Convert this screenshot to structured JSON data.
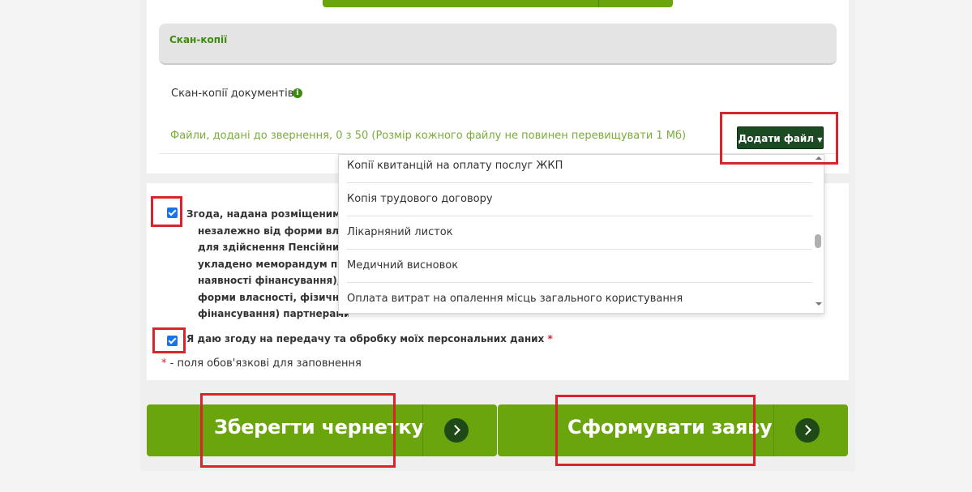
{
  "scans": {
    "header": "Скан-копії",
    "documents_label": "Скан-копії документів",
    "files_status": "Файли, додані до звернення, 0 з 50 (Розмір кожного файлу не повинен перевищувати 1 Мб)",
    "add_file_label": "Додати файл",
    "dropdown_items": [
      "Копії квитанцій на оплату послуг ЖКП",
      "Копія трудового договору",
      "Лікарняний листок",
      "Медичний висновок",
      "Оплата витрат на опалення місць загального користування"
    ]
  },
  "consent": {
    "lines": [
      "Згода, надана розміщеними в",
      "незалежно від форми власно",
      "для здійснення Пенсійним фо",
      "укладено меморандум про вз",
      "наявності фінансування), випл",
      "форми власності, фізичним ос",
      "фінансування) партнерами, до"
    ],
    "personal_data_label": "Я даю згоду на передачу та обробку моїх персональних даних",
    "required_star": "*",
    "required_note": "- поля обов'язкові для заповнення"
  },
  "actions": {
    "save_draft_label": "Зберегти чернетку",
    "submit_label": "Сформувати заяву"
  },
  "colors": {
    "accent_green": "#6aa50d",
    "dark_green": "#1c4a22",
    "highlight_red": "#d9232d",
    "checkbox_blue": "#1a73e8"
  }
}
